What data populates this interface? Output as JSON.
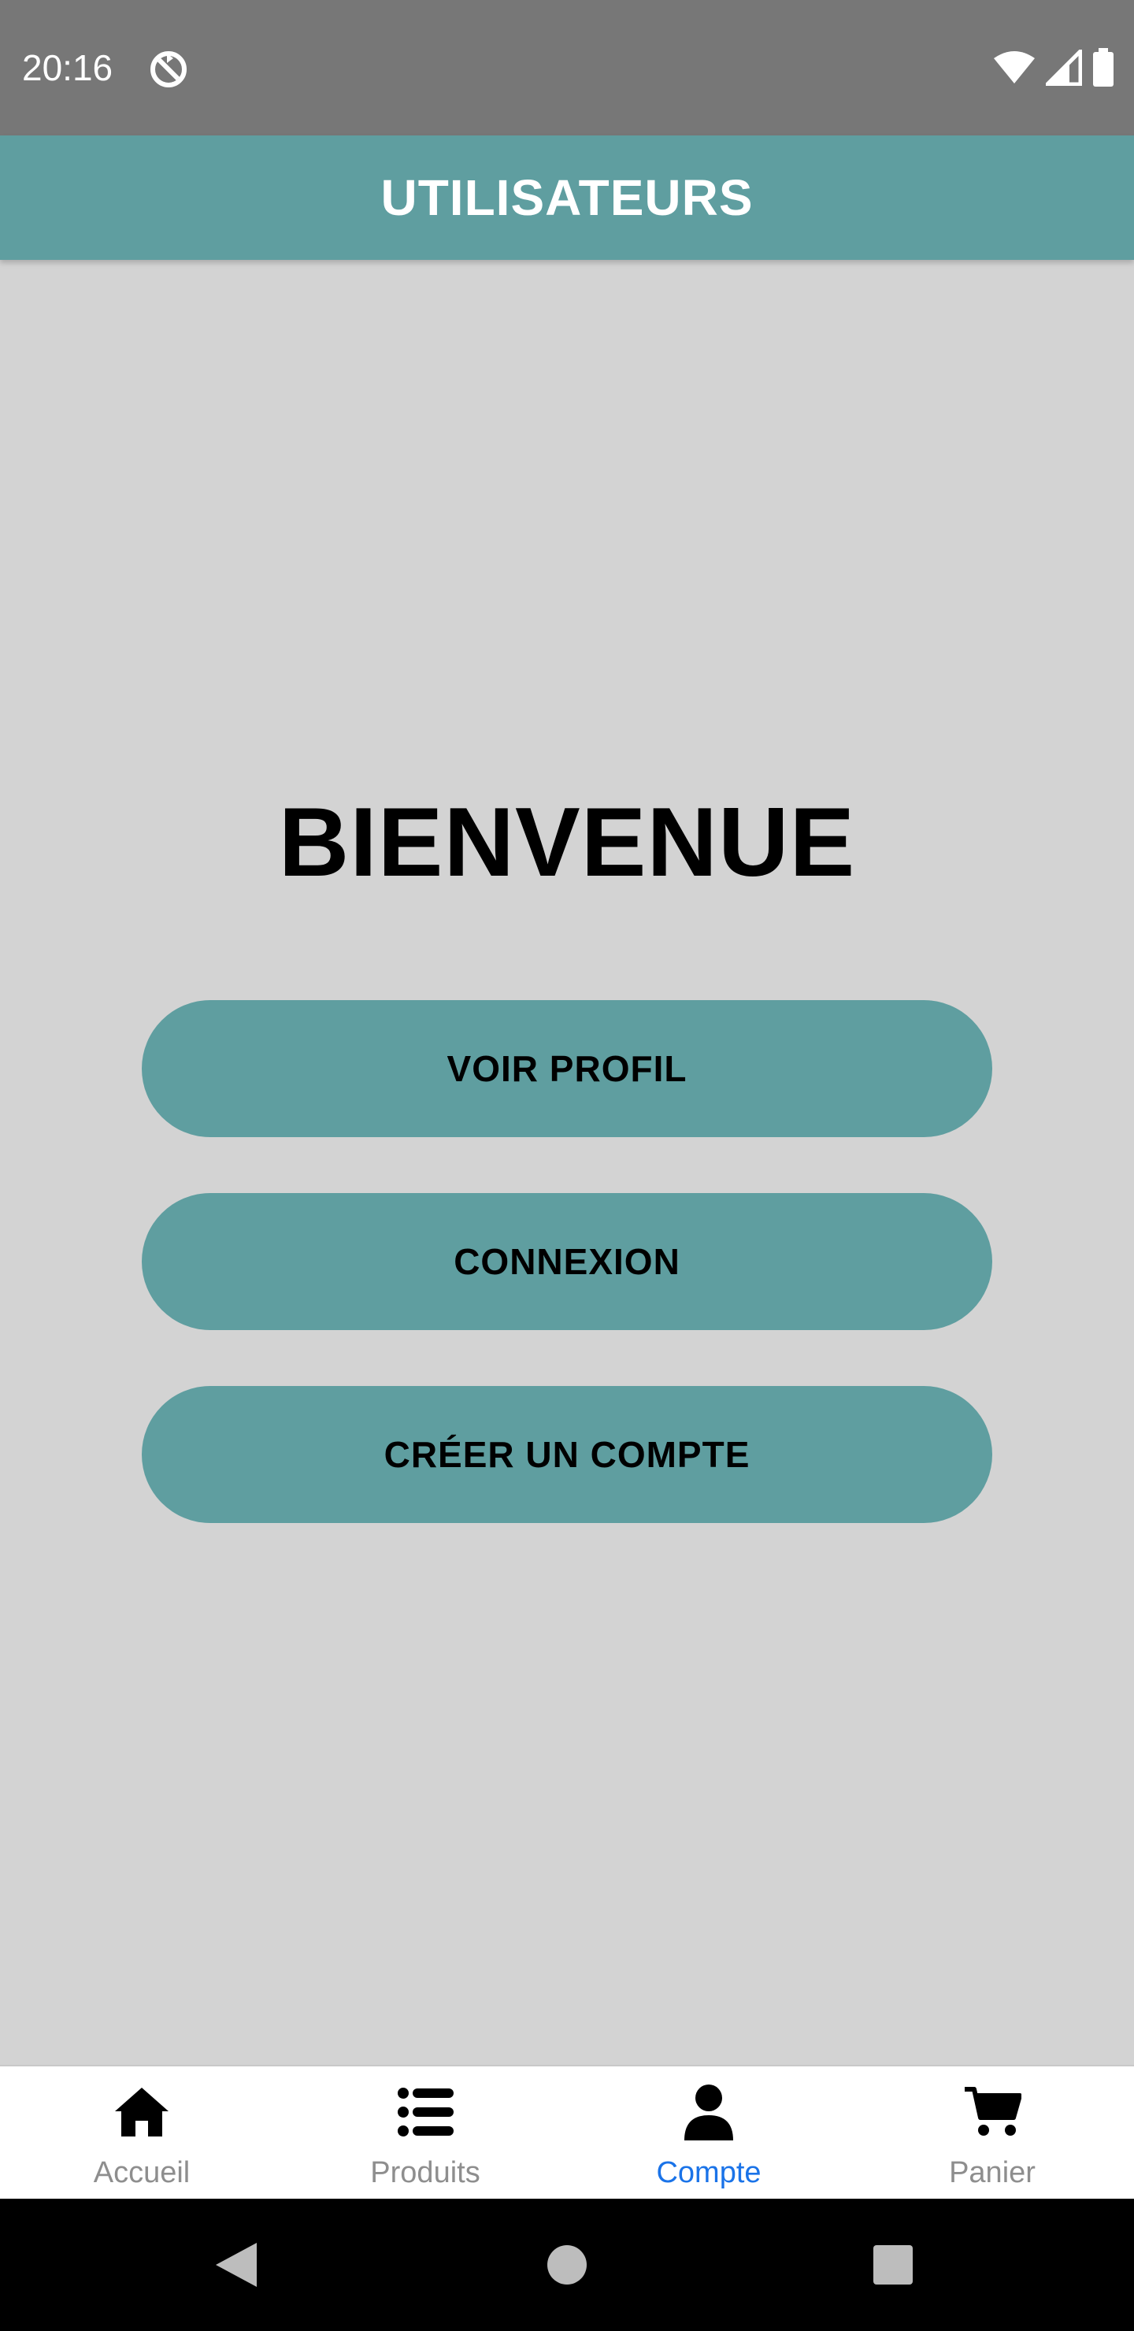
{
  "status_bar": {
    "time": "20:16",
    "app_icon": "sync-disabled-icon",
    "icons": [
      "wifi-icon",
      "cellular-signal-icon",
      "battery-icon"
    ]
  },
  "app_bar": {
    "title": "UTILISATEURS"
  },
  "main": {
    "welcome": "BIENVENUE",
    "buttons": {
      "view_profile": "VOIR PROFIL",
      "login": "CONNEXION",
      "create_account": "CRÉER UN COMPTE"
    }
  },
  "bottom_nav": {
    "items": [
      {
        "label": "Accueil",
        "icon": "home-icon"
      },
      {
        "label": "Produits",
        "icon": "list-icon"
      },
      {
        "label": "Compte",
        "icon": "person-icon",
        "active": true
      },
      {
        "label": "Panier",
        "icon": "cart-icon"
      }
    ]
  },
  "system_nav": {
    "buttons": [
      "back-icon",
      "home-circle-icon",
      "recents-icon"
    ]
  },
  "colors": {
    "accent": "#5f9ea0",
    "active_nav": "#1a73e8",
    "background": "#d3d3d3",
    "status_bar": "#777777"
  }
}
